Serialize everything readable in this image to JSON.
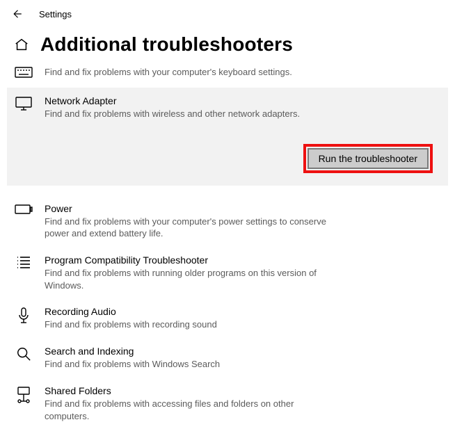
{
  "window": {
    "title": "Settings"
  },
  "page": {
    "title": "Additional troubleshooters"
  },
  "items": [
    {
      "title": "",
      "desc": "Find and fix problems with your computer's keyboard settings."
    },
    {
      "title": "Network Adapter",
      "desc": "Find and fix problems with wireless and other network adapters."
    },
    {
      "title": "Power",
      "desc": "Find and fix problems with your computer's power settings to conserve power and extend battery life."
    },
    {
      "title": "Program Compatibility Troubleshooter",
      "desc": "Find and fix problems with running older programs on this version of Windows."
    },
    {
      "title": "Recording Audio",
      "desc": "Find and fix problems with recording sound"
    },
    {
      "title": "Search and Indexing",
      "desc": "Find and fix problems with Windows Search"
    },
    {
      "title": "Shared Folders",
      "desc": "Find and fix problems with accessing files and folders on other computers."
    }
  ],
  "actions": {
    "run_label": "Run the troubleshooter"
  }
}
